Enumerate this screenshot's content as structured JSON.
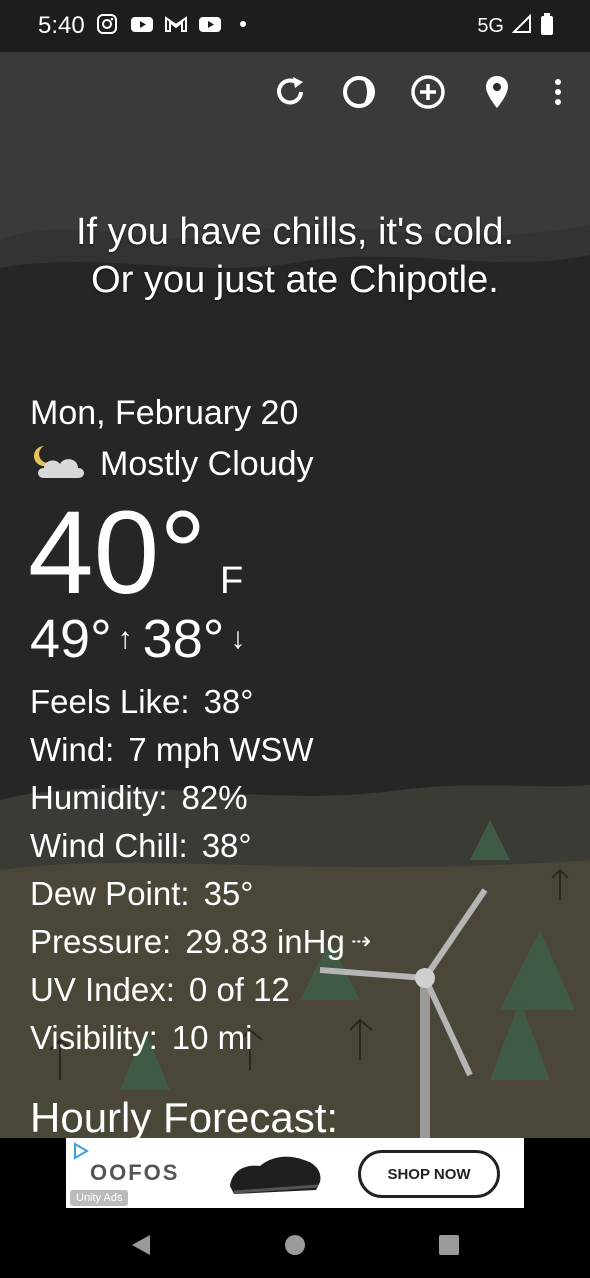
{
  "status_bar": {
    "time": "5:40",
    "network": "5G"
  },
  "toolbar": {
    "icons": [
      "refresh-icon",
      "radar-icon",
      "add-location-icon",
      "location-pin-icon",
      "more-icon"
    ]
  },
  "quote": {
    "line1": "If you have chills, it's cold.",
    "line2": "Or you just ate Chipotle."
  },
  "weather": {
    "date": "Mon, February 20",
    "condition": "Mostly Cloudy",
    "temperature": "40°",
    "unit": "F",
    "high": "49°",
    "low": "38°"
  },
  "details": [
    {
      "label": "Feels Like:",
      "value": "38°"
    },
    {
      "label": "Wind:",
      "value": "7 mph WSW"
    },
    {
      "label": "Humidity:",
      "value": "82%"
    },
    {
      "label": "Wind Chill:",
      "value": "38°"
    },
    {
      "label": "Dew Point:",
      "value": "35°"
    },
    {
      "label": "Pressure:",
      "value": "29.83 inHg"
    },
    {
      "label": "UV Index:",
      "value": "0 of 12"
    },
    {
      "label": "Visibility:",
      "value": "10 mi"
    }
  ],
  "hourly": {
    "title": "Hourly Forecast:"
  },
  "ad": {
    "brand": "OOFOS",
    "cta": "SHOP NOW",
    "network": "Unity Ads"
  },
  "colors": {
    "background": "#2a2a2a",
    "text": "#ffffff"
  }
}
